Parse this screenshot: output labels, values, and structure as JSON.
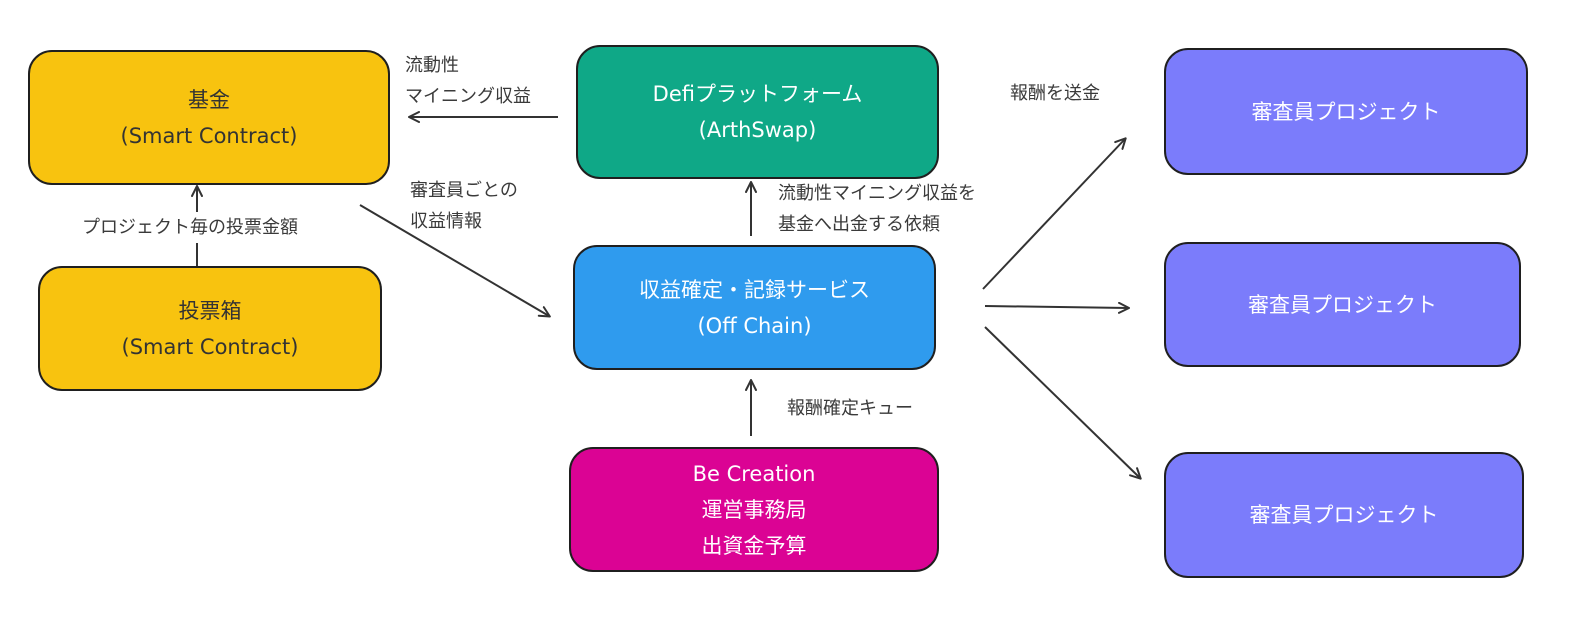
{
  "colors": {
    "fund": "#F8C30F",
    "defi": "#0FA887",
    "service": "#2F9BEE",
    "funding": "#DB0394",
    "project": "#7B7CFB",
    "stroke": "#1F1F1F",
    "arrow": "#333333"
  },
  "nodes": {
    "fund": {
      "title": "基金",
      "subtitle": "(Smart Contract)"
    },
    "ballot": {
      "title": "投票箱",
      "subtitle": "(Smart Contract)"
    },
    "defi": {
      "title": "Defiプラットフォーム",
      "subtitle": "(ArthSwap)"
    },
    "service": {
      "title": "収益確定・記録サービス",
      "subtitle": "(Off Chain)"
    },
    "funding": {
      "line1": "Be Creation",
      "line2": "運営事務局",
      "line3": "出資金予算"
    },
    "projects": [
      {
        "label": "審査員プロジェクト"
      },
      {
        "label": "審査員プロジェクト"
      },
      {
        "label": "審査員プロジェクト"
      }
    ]
  },
  "edge_labels": {
    "liquidity_to_fund": {
      "line1": "流動性",
      "line2": "マイニング収益"
    },
    "ballot_to_fund": "プロジェクト毎の投票金額",
    "fund_to_service": {
      "line1": "審査員ごとの",
      "line2": "収益情報"
    },
    "service_to_defi": {
      "line1": "流動性マイニング収益を",
      "line2": "基金へ出金する依頼"
    },
    "funding_to_service": "報酬確定キュー",
    "service_to_projects": "報酬を送金"
  }
}
